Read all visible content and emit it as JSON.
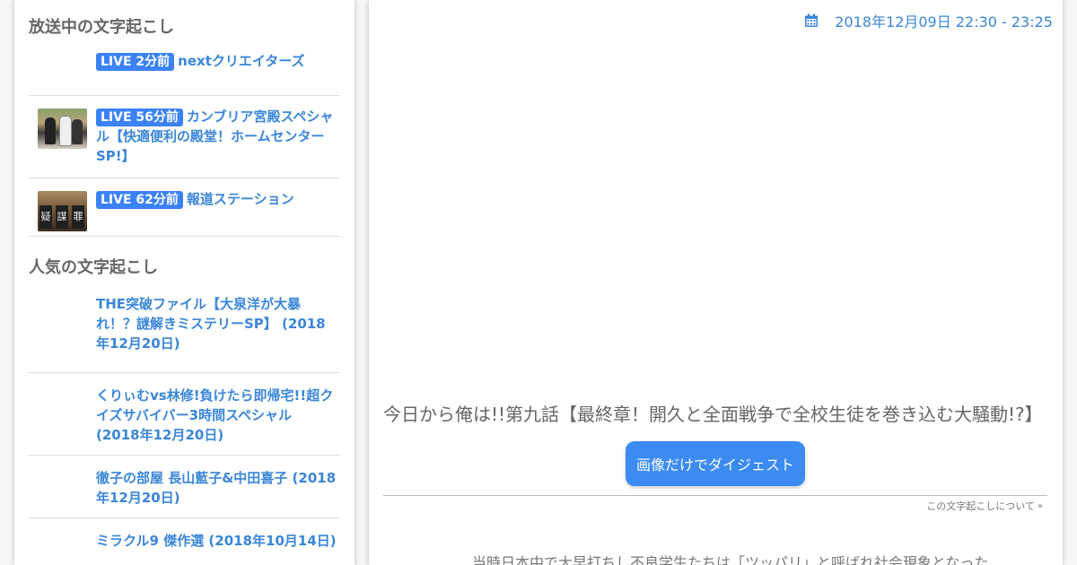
{
  "sidebar": {
    "live_title": "放送中の文字起こし",
    "live_items": [
      {
        "badge": "LIVE 2分前",
        "title": "nextクリエイターズ"
      },
      {
        "badge": "LIVE 56分前",
        "title": "カンブリア宮殿スペシャル【快適便利の殿堂！ホームセンターSP!】"
      },
      {
        "badge": "LIVE 62分前",
        "title": "報道ステーション"
      }
    ],
    "popular_title": "人気の文字起こし",
    "popular_items": [
      {
        "title": "THE突破ファイル【大泉洋が大暴れ！？謎解きミステリーSP】 (2018年12月20日)"
      },
      {
        "title": "くりぃむvs林修!負けたら即帰宅!!超クイズサバイバー3時間スペシャル (2018年12月20日)"
      },
      {
        "title": "徹子の部屋 長山藍子&中田喜子 (2018年12月20日)"
      },
      {
        "title": "ミラクル9 傑作選 (2018年10月14日)"
      }
    ],
    "thumb2_text": [
      "疑",
      "謀",
      "罪"
    ]
  },
  "main": {
    "date_range": "2018年12月09日 22:30 - 23:25",
    "episode_title": "今日から俺は!!第九話【最終章！開久と全面戦争で全校生徒を巻き込む大騒動!?】",
    "digest_button": "画像だけでダイジェスト",
    "about_link": "この文字起こしについて",
    "about_chevron": "»",
    "body_preview": "当時日本中で大早打ちし不良学生たちは「ツッパリ」と呼ばれ社会現象となった"
  },
  "icons": {
    "calendar": "calendar-icon",
    "chevron": "chevron-double-down-icon"
  },
  "colors": {
    "accent": "#3b82f6",
    "link": "#3a86d9",
    "button": "#3b8bf2"
  }
}
